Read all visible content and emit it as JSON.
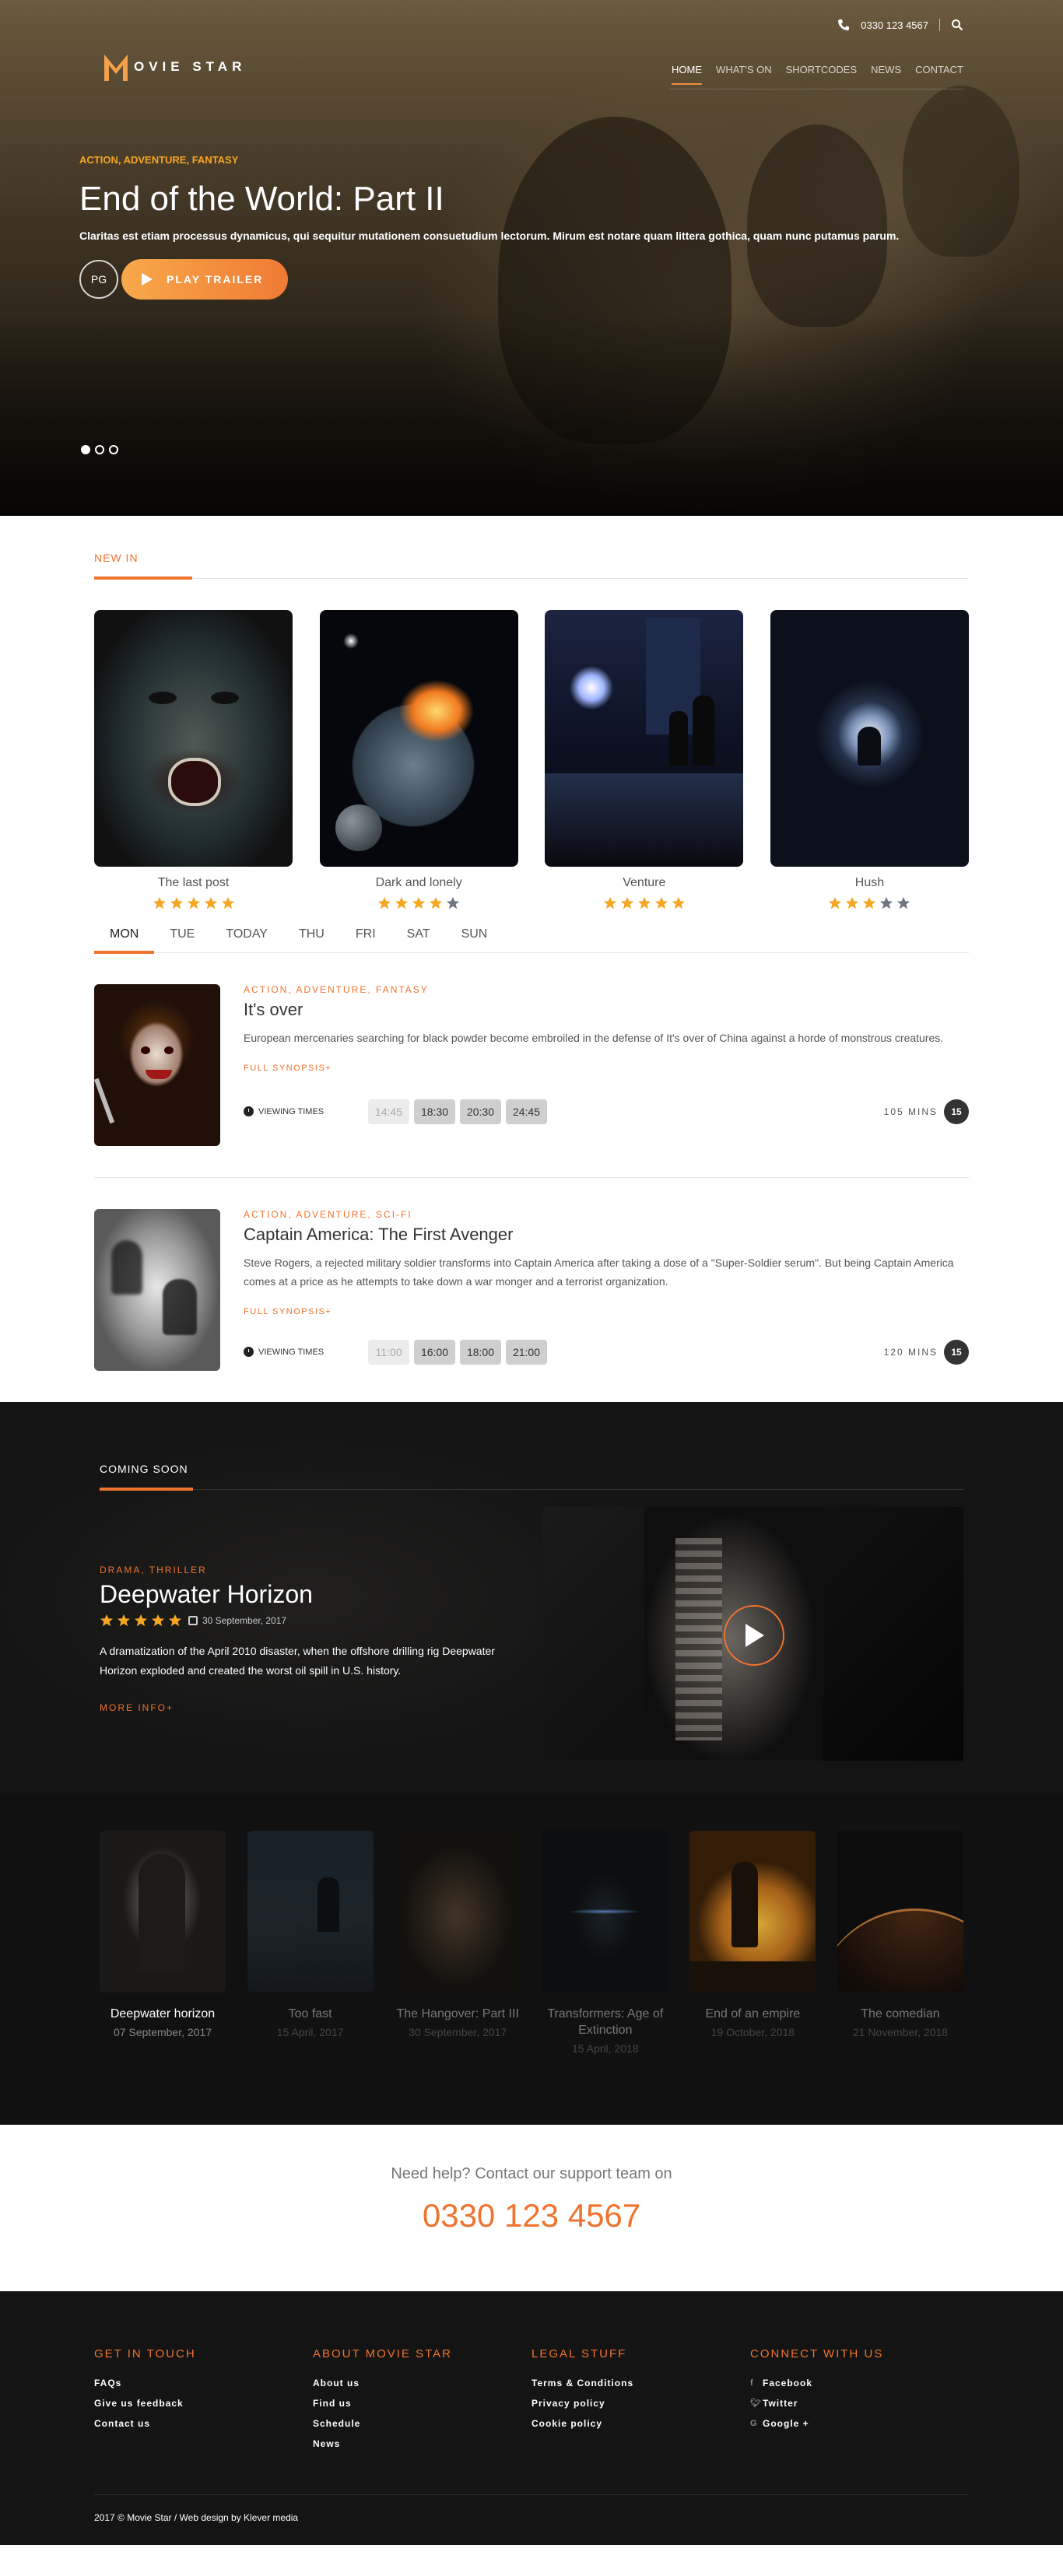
{
  "header": {
    "phone": "0330 123 4567",
    "logo_text": "OVIE STAR",
    "nav": [
      {
        "label": "HOME",
        "active": true
      },
      {
        "label": "WHAT'S ON",
        "active": false
      },
      {
        "label": "SHORTCODES",
        "active": false
      },
      {
        "label": "NEWS",
        "active": false
      },
      {
        "label": "CONTACT",
        "active": false
      }
    ]
  },
  "hero": {
    "genre": "ACTION, ADVENTURE, FANTASY",
    "title": "End of the World: Part II",
    "description": "Claritas est etiam processus dynamicus, qui sequitur mutationem consuetudium lectorum. Mirum est notare quam littera gothica, quam nunc putamus parum.",
    "rating": "PG",
    "trailer_label": "PLAY TRAILER",
    "slides": 3,
    "active_slide": 1
  },
  "new_in": {
    "label": "NEW IN",
    "movies": [
      {
        "title": "The last post",
        "stars": 5
      },
      {
        "title": "Dark and lonely",
        "stars": 4
      },
      {
        "title": "Venture",
        "stars": 5
      },
      {
        "title": "Hush",
        "stars": 3
      }
    ],
    "days": [
      "MON",
      "TUE",
      "TODAY",
      "THU",
      "FRI",
      "SAT",
      "SUN"
    ],
    "active_day": "MON",
    "viewing_label": "VIEWING TIMES",
    "synopsis_label": "FULL SYNOPSIS+",
    "listings": [
      {
        "genre": "ACTION, ADVENTURE, FANTASY",
        "title": "It's over",
        "description": "European mercenaries searching for black powder become embroiled in the defense of It's over of China against a horde of monstrous creatures.",
        "times": [
          {
            "t": "14:45",
            "past": true
          },
          {
            "t": "18:30",
            "past": false
          },
          {
            "t": "20:30",
            "past": false
          },
          {
            "t": "24:45",
            "past": false
          }
        ],
        "duration": "105 MINS",
        "rating": "15"
      },
      {
        "genre": "ACTION, ADVENTURE, SCI-FI",
        "title": "Captain America: The First Avenger",
        "description": "Steve Rogers, a rejected military soldier transforms into Captain America after taking a dose of a \"Super-Soldier serum\". But being Captain America comes at a price as he attempts to take down a war monger and a terrorist organization.",
        "times": [
          {
            "t": "11:00",
            "past": true
          },
          {
            "t": "16:00",
            "past": false
          },
          {
            "t": "18:00",
            "past": false
          },
          {
            "t": "21:00",
            "past": false
          }
        ],
        "duration": "120 MINS",
        "rating": "15"
      }
    ]
  },
  "coming_soon": {
    "label": "COMING SOON",
    "genre": "DRAMA, THRILLER",
    "title": "Deepwater Horizon",
    "stars": 5,
    "date": "30 September, 2017",
    "description": "A dramatization of the April 2010 disaster, when the offshore drilling rig Deepwater Horizon exploded and created the worst oil spill in U.S. history.",
    "more_label": "MORE INFO+",
    "films": [
      {
        "title": "Deepwater horizon",
        "date": "07 September, 2017",
        "active": true
      },
      {
        "title": "Too fast",
        "date": "15 April, 2017",
        "active": false
      },
      {
        "title": "The Hangover: Part III",
        "date": "30 September, 2017",
        "active": false
      },
      {
        "title": "Transformers: Age of Extinction",
        "date": "15 April, 2018",
        "active": false
      },
      {
        "title": "End of an empire",
        "date": "19 October, 2018",
        "active": false
      },
      {
        "title": "The comedian",
        "date": "21 November, 2018",
        "active": false
      }
    ]
  },
  "help": {
    "text": "Need help? Contact our support team on",
    "phone": "0330 123 4567"
  },
  "footer": {
    "columns": [
      {
        "heading": "GET IN TOUCH",
        "links": [
          "FAQs",
          "Give us feedback",
          "Contact us"
        ]
      },
      {
        "heading": "ABOUT MOVIE STAR",
        "links": [
          "About us",
          "Find us",
          "Schedule",
          "News"
        ]
      },
      {
        "heading": "LEGAL STUFF",
        "links": [
          "Terms & Conditions",
          "Privacy policy",
          "Cookie policy"
        ]
      },
      {
        "heading": "CONNECT WITH US",
        "links": [
          "Facebook",
          "Twitter",
          "Google +"
        ]
      }
    ],
    "social_icons": [
      "facebook-icon",
      "twitter-icon",
      "google-plus-icon"
    ],
    "copyright": "2017 © Movie Star / Web design by Klever media"
  },
  "colors": {
    "accent": "#f0732e",
    "star": "#f5a623",
    "dark": "#141414"
  }
}
